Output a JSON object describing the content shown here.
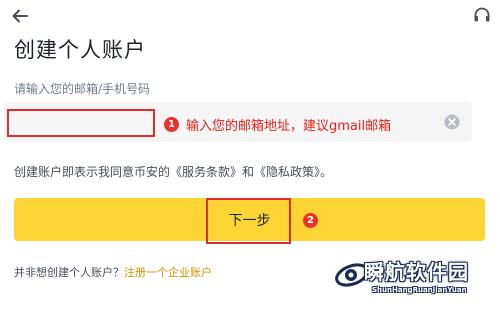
{
  "header": {
    "back_icon": "arrow-left-icon",
    "support_icon": "headset-icon"
  },
  "title": "创建个人账户",
  "form": {
    "field_label": "请输入您的邮箱/手机号码",
    "email_value": "",
    "clear_icon": "clear-circle-icon"
  },
  "annotations": {
    "step1_number": "1",
    "step1_text": "输入您的邮箱地址，建议gmail邮箱",
    "step2_number": "2",
    "highlight_color": "#e02b30"
  },
  "agreement": {
    "prefix": "创建账户即表示我同意币安的",
    "terms": "《服务条款》",
    "and": "和",
    "privacy": "《隐私政策》",
    "suffix": "。"
  },
  "next_button": {
    "label": "下一步",
    "color": "#fcd535"
  },
  "enterprise": {
    "question": "并非想创建个人账户？",
    "link": "注册一个企业账户",
    "link_color": "#c99400"
  },
  "watermark": {
    "title": "瞬航软件园",
    "subtitle": "ShunHangRuanJianYuan"
  }
}
